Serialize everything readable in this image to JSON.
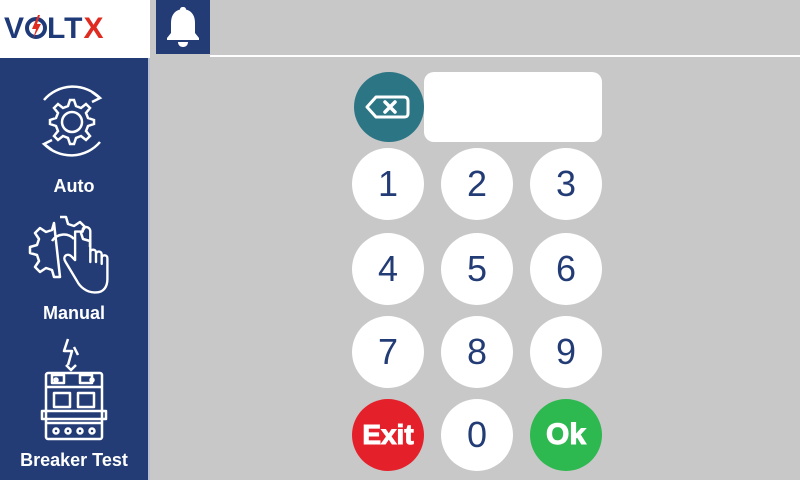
{
  "brand": {
    "logo_text_left": "V",
    "logo_text_mid": "LT",
    "logo_text_right": "X"
  },
  "header": {
    "notification_icon": "bell-icon"
  },
  "sidebar": {
    "items": [
      {
        "label": "Auto",
        "icon": "auto-gear-cycle-icon"
      },
      {
        "label": "Manual",
        "icon": "manual-gear-hand-icon"
      },
      {
        "label": "Breaker Test",
        "icon": "circuit-breaker-icon"
      }
    ]
  },
  "keypad": {
    "display_value": "",
    "backspace_icon": "backspace-icon",
    "keys": [
      "1",
      "2",
      "3",
      "4",
      "5",
      "6",
      "7",
      "8",
      "9"
    ],
    "zero": "0",
    "exit_label": "Exit",
    "ok_label": "Ok"
  },
  "colors": {
    "sidebar": "#233c75",
    "backspace": "#2c7584",
    "exit": "#e4212a",
    "ok": "#2eb850",
    "background": "#c8c8c8"
  }
}
